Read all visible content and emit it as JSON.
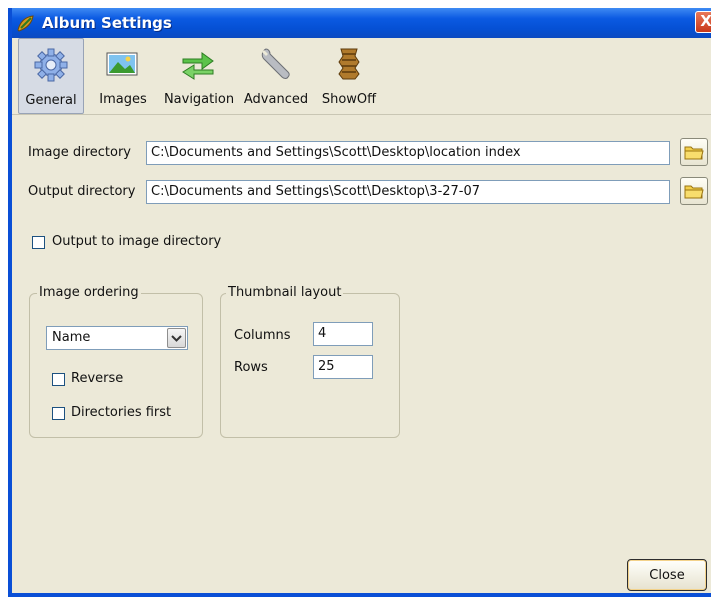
{
  "window": {
    "title": "Album Settings",
    "close_glyph": "X"
  },
  "toolbar": {
    "items": [
      {
        "label": "General",
        "icon": "gear-icon",
        "selected": true
      },
      {
        "label": "Images",
        "icon": "picture-icon"
      },
      {
        "label": "Navigation",
        "icon": "arrows-icon"
      },
      {
        "label": "Advanced",
        "icon": "wrench-icon"
      },
      {
        "label": "ShowOff",
        "icon": "showoff-icon"
      }
    ]
  },
  "general": {
    "image_directory": {
      "label": "Image directory",
      "value": "C:\\Documents and Settings\\Scott\\Desktop\\location index"
    },
    "output_directory": {
      "label": "Output directory",
      "value": "C:\\Documents and Settings\\Scott\\Desktop\\3-27-07"
    },
    "output_to_image_dir": {
      "label": "Output to image directory",
      "checked": false
    },
    "image_ordering": {
      "legend": "Image ordering",
      "selected": "Name",
      "reverse": {
        "label": "Reverse",
        "checked": false
      },
      "directories_first": {
        "label": "Directories first",
        "checked": false
      }
    },
    "thumbnail_layout": {
      "legend": "Thumbnail layout",
      "columns": {
        "label": "Columns",
        "value": "4"
      },
      "rows": {
        "label": "Rows",
        "value": "25"
      }
    }
  },
  "footer": {
    "close_label": "Close"
  },
  "colors": {
    "titlebar": "#0550d4",
    "dialog_bg": "#ece9d8",
    "selected_tab_bg": "#d6dbe4"
  }
}
